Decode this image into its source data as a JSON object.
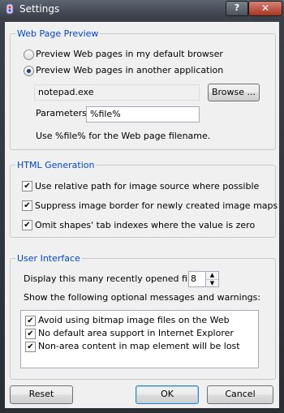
{
  "window": {
    "title": "Settings",
    "help_label": "?",
    "close_label": "✕"
  },
  "web_preview": {
    "legend": "Web Page Preview",
    "option_default_browser": "Preview Web pages in my default browser",
    "option_another_app": "Preview Web pages in another application",
    "selected_option": "another_app",
    "application_path": "notepad.exe",
    "browse_label": "Browse ...",
    "parameters_label": "Parameters",
    "parameters_value": "%file%",
    "hint": "Use %file% for the Web page filename."
  },
  "html_generation": {
    "legend": "HTML Generation",
    "options": [
      {
        "label": "Use relative path for image source where possible",
        "checked": true
      },
      {
        "label": "Suppress image border for newly created image maps",
        "checked": true
      },
      {
        "label": "Omit shapes' tab indexes where the value is zero",
        "checked": true
      }
    ]
  },
  "user_interface": {
    "legend": "User Interface",
    "recent_files_label": "Display this many recently opened files",
    "recent_files_value": "8",
    "messages_label": "Show the following optional messages and warnings:",
    "messages": [
      {
        "label": "Avoid using bitmap image files on the Web",
        "checked": true
      },
      {
        "label": "No default area support in Internet Explorer",
        "checked": true
      },
      {
        "label": "Non-area content in map element will be lost",
        "checked": true
      }
    ]
  },
  "buttons": {
    "reset": "Reset",
    "ok": "OK",
    "cancel": "Cancel"
  }
}
